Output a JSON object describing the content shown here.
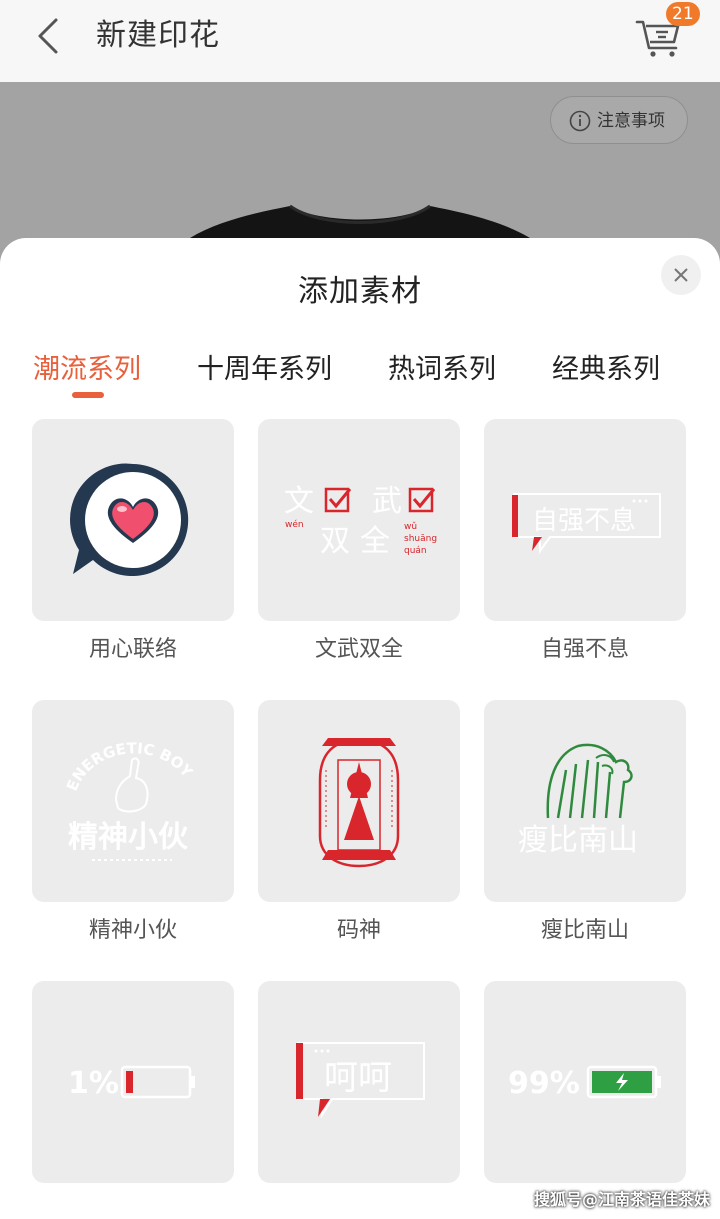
{
  "header": {
    "title": "新建印花",
    "cart_count": "21"
  },
  "preview": {
    "notice_label": "注意事项"
  },
  "sheet": {
    "title": "添加素材",
    "tabs": [
      {
        "label": "潮流系列",
        "active": true
      },
      {
        "label": "十周年系列",
        "active": false
      },
      {
        "label": "热词系列",
        "active": false
      },
      {
        "label": "经典系列",
        "active": false
      }
    ],
    "items": [
      {
        "name": "用心联络",
        "icon": "heart-chat-icon"
      },
      {
        "name": "文武双全",
        "icon": "wenwu-text-art",
        "art": {
          "c1": "文",
          "c2": "武",
          "c3": "双",
          "c4": "全",
          "p1": "wén",
          "p2": "wǔ",
          "p3": "shuāng",
          "p4": "quán"
        }
      },
      {
        "name": "自强不息",
        "icon": "ziqiang-bubble-art",
        "art": {
          "text": "自强不息"
        }
      },
      {
        "name": "精神小伙",
        "icon": "energetic-boy-art",
        "art": {
          "arc": "ENERGETIC BOY",
          "text": "精神小伙"
        }
      },
      {
        "name": "码神",
        "icon": "code-god-badge-art"
      },
      {
        "name": "瘦比南山",
        "icon": "mountain-art",
        "art": {
          "text": "瘦比南山"
        }
      },
      {
        "name": "",
        "icon": "battery-low-art",
        "art": {
          "text": "1%"
        }
      },
      {
        "name": "",
        "icon": "hehe-bubble-art",
        "art": {
          "text": "呵呵"
        }
      },
      {
        "name": "",
        "icon": "battery-full-art",
        "art": {
          "text": "99%"
        }
      }
    ]
  },
  "watermark": "搜狐号@江南茶语佳茶妹",
  "colors": {
    "accent": "#e8603c",
    "badge": "#f07a2a",
    "red": "#d8262c",
    "green": "#2f8a3e"
  }
}
